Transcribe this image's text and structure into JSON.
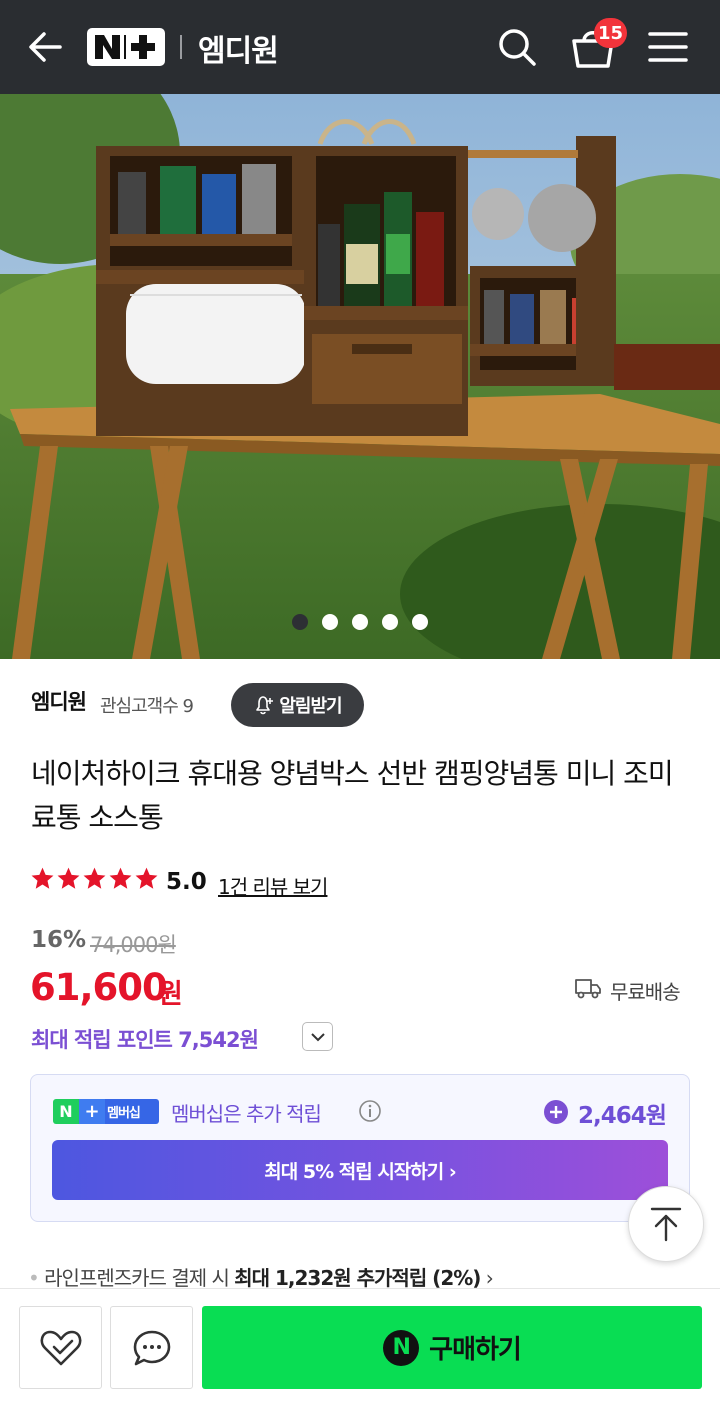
{
  "header": {
    "logo": "N+",
    "brand": "엠디원",
    "cart_count": "15"
  },
  "hero": {
    "slide_count": 5,
    "active_slide": 1,
    "image_desc": "wooden camping spice rack on folding table outdoors"
  },
  "store": {
    "name": "엠디원",
    "followers": "관심고객수 9",
    "alert_label": "알림받기"
  },
  "product": {
    "title": "네이처하이크 휴대용 양념박스 선반 캠핑양념통 미니 조미료통 소스통",
    "rating": "5.0",
    "stars": 5,
    "review_link": "1건 리뷰 보기",
    "discount": "16%",
    "original_price": "74,000원",
    "price": "61,600",
    "price_unit": "원",
    "shipping": "무료배송",
    "points": "최대 적립 포인트 7,542원"
  },
  "membership": {
    "logo_text": "멤버십",
    "text": "멤버십은 추가 적립",
    "points": "2,464원",
    "button": "최대 5% 적립 시작하기 ›"
  },
  "card_benefit": {
    "prefix": "라인프렌즈카드 결제 시 ",
    "bold": "최대 1,232원 추가적립 (2%)",
    "suffix": " ›"
  },
  "bottom": {
    "buy_label": "구매하기",
    "buy_icon": "N"
  },
  "colors": {
    "header_bg": "#2a2d31",
    "price_red": "#e4142a",
    "point_purple": "#7b4fd3",
    "buy_green": "#09dd53",
    "badge_red": "#f2343b"
  }
}
